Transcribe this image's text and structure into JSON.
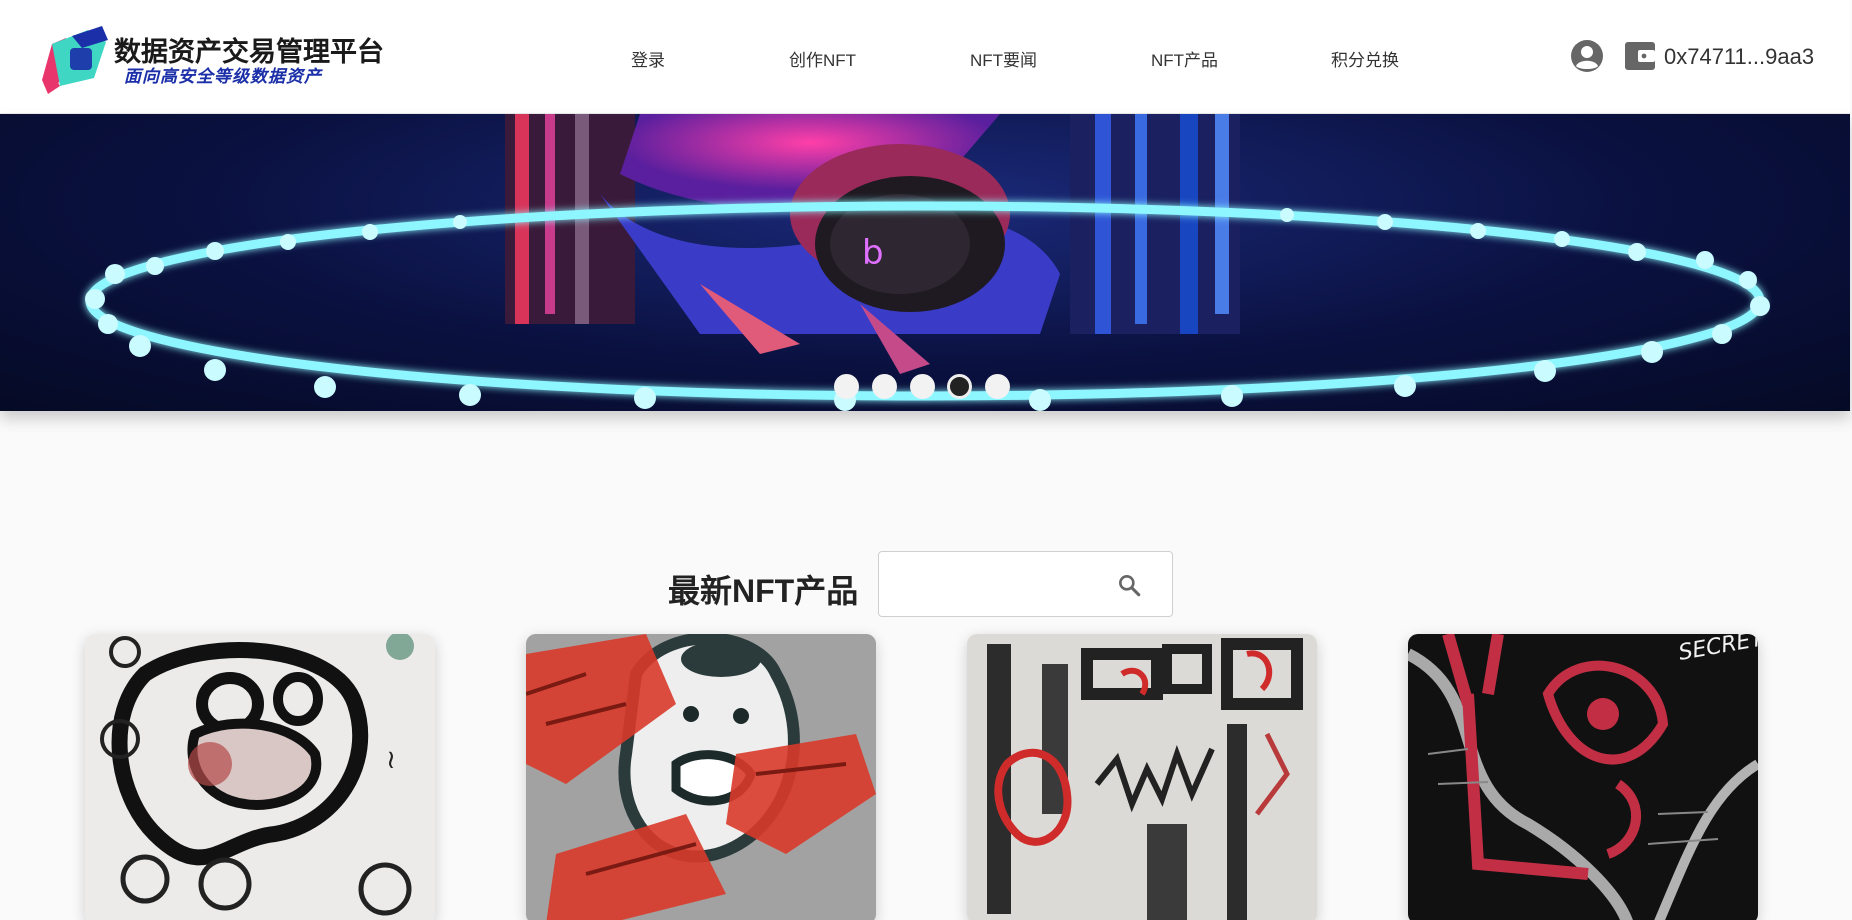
{
  "header": {
    "logo": {
      "title": "数据资产交易管理平台",
      "subtitle": "面向高安全等级数据资产",
      "icon": "logo-icon"
    },
    "nav": [
      {
        "label": "登录"
      },
      {
        "label": "创作NFT"
      },
      {
        "label": "NFT要闻"
      },
      {
        "label": "NFT产品"
      },
      {
        "label": "积分兑换"
      }
    ],
    "user_icon": "account-circle-icon",
    "wallet_icon": "wallet-icon",
    "wallet_address": "0x74711...9aa3"
  },
  "banner": {
    "slide_count": 5,
    "active_slide": 4
  },
  "products": {
    "title": "最新NFT产品",
    "search": {
      "placeholder": "",
      "value": "",
      "icon": "search-icon"
    },
    "cards": [
      {
        "artwork": "white-doodle-face-artwork"
      },
      {
        "artwork": "red-gray-doodle-artwork"
      },
      {
        "artwork": "gray-red-sketch-artwork"
      },
      {
        "artwork": "black-red-eye-artwork",
        "text": "SECRET!"
      }
    ]
  },
  "colors": {
    "brand_blue": "#1b2fa8",
    "banner_ring": "#8ef6ff",
    "header_bg": "#ffffff",
    "page_bg": "#fafafa"
  }
}
